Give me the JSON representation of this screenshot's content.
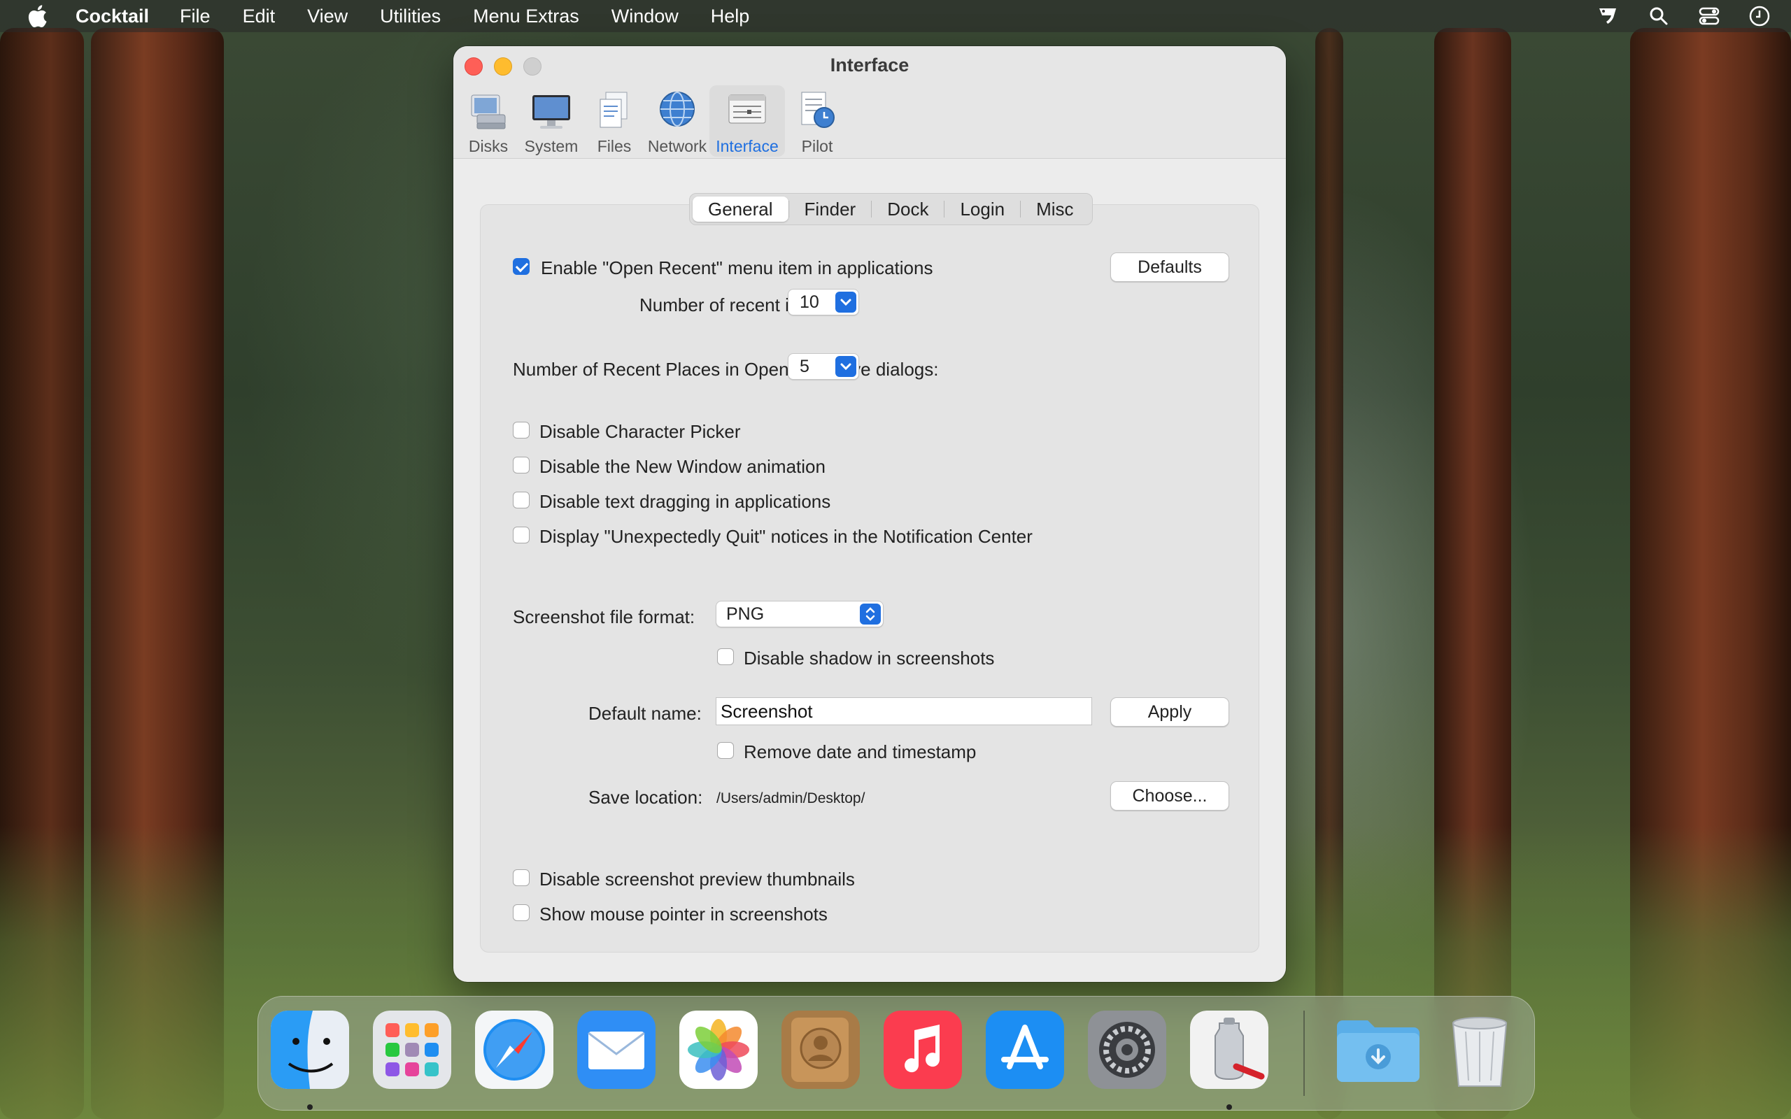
{
  "menubar": {
    "app_name": "Cocktail",
    "items": [
      "File",
      "Edit",
      "View",
      "Utilities",
      "Menu Extras",
      "Window",
      "Help"
    ]
  },
  "window": {
    "title": "Interface",
    "toolbar": [
      {
        "label": "Disks",
        "icon": "disks-icon"
      },
      {
        "label": "System",
        "icon": "system-icon"
      },
      {
        "label": "Files",
        "icon": "files-icon"
      },
      {
        "label": "Network",
        "icon": "network-icon"
      },
      {
        "label": "Interface",
        "icon": "interface-icon",
        "selected": true
      },
      {
        "label": "Pilot",
        "icon": "pilot-icon"
      }
    ],
    "tabs": [
      "General",
      "Finder",
      "Dock",
      "Login",
      "Misc"
    ],
    "selected_tab": "General"
  },
  "general": {
    "open_recent_label": "Enable \"Open Recent\" menu item in applications",
    "open_recent_checked": true,
    "defaults_button": "Defaults",
    "recent_items_label": "Number of recent items:",
    "recent_items_value": "10",
    "recent_places_label": "Number of Recent Places in Open and Save dialogs:",
    "recent_places_value": "5",
    "options": [
      {
        "label": "Disable Character Picker",
        "checked": false
      },
      {
        "label": "Disable the New Window animation",
        "checked": false
      },
      {
        "label": "Disable text dragging in applications",
        "checked": false
      },
      {
        "label": "Display \"Unexpectedly Quit\" notices in the Notification Center",
        "checked": false
      }
    ],
    "screenshot_format_label": "Screenshot file format:",
    "screenshot_format_value": "PNG",
    "disable_shadow_label": "Disable shadow in screenshots",
    "default_name_label": "Default name:",
    "default_name_value": "Screenshot",
    "apply_button": "Apply",
    "remove_date_label": "Remove date and timestamp",
    "save_location_label": "Save location:",
    "save_location_value": "/Users/admin/Desktop/",
    "choose_button": "Choose...",
    "disable_thumbnails_label": "Disable screenshot preview thumbnails",
    "show_pointer_label": "Show mouse pointer in screenshots"
  },
  "dock": {
    "apps": [
      "finder-icon",
      "launchpad-icon",
      "safari-icon",
      "mail-icon",
      "photos-icon",
      "contacts-icon",
      "music-icon",
      "app-store-icon",
      "system-settings-icon",
      "cocktail-icon"
    ],
    "others": [
      "downloads-folder-icon",
      "trash-icon"
    ],
    "colors": {
      "accent": "#1f6fe0"
    }
  }
}
